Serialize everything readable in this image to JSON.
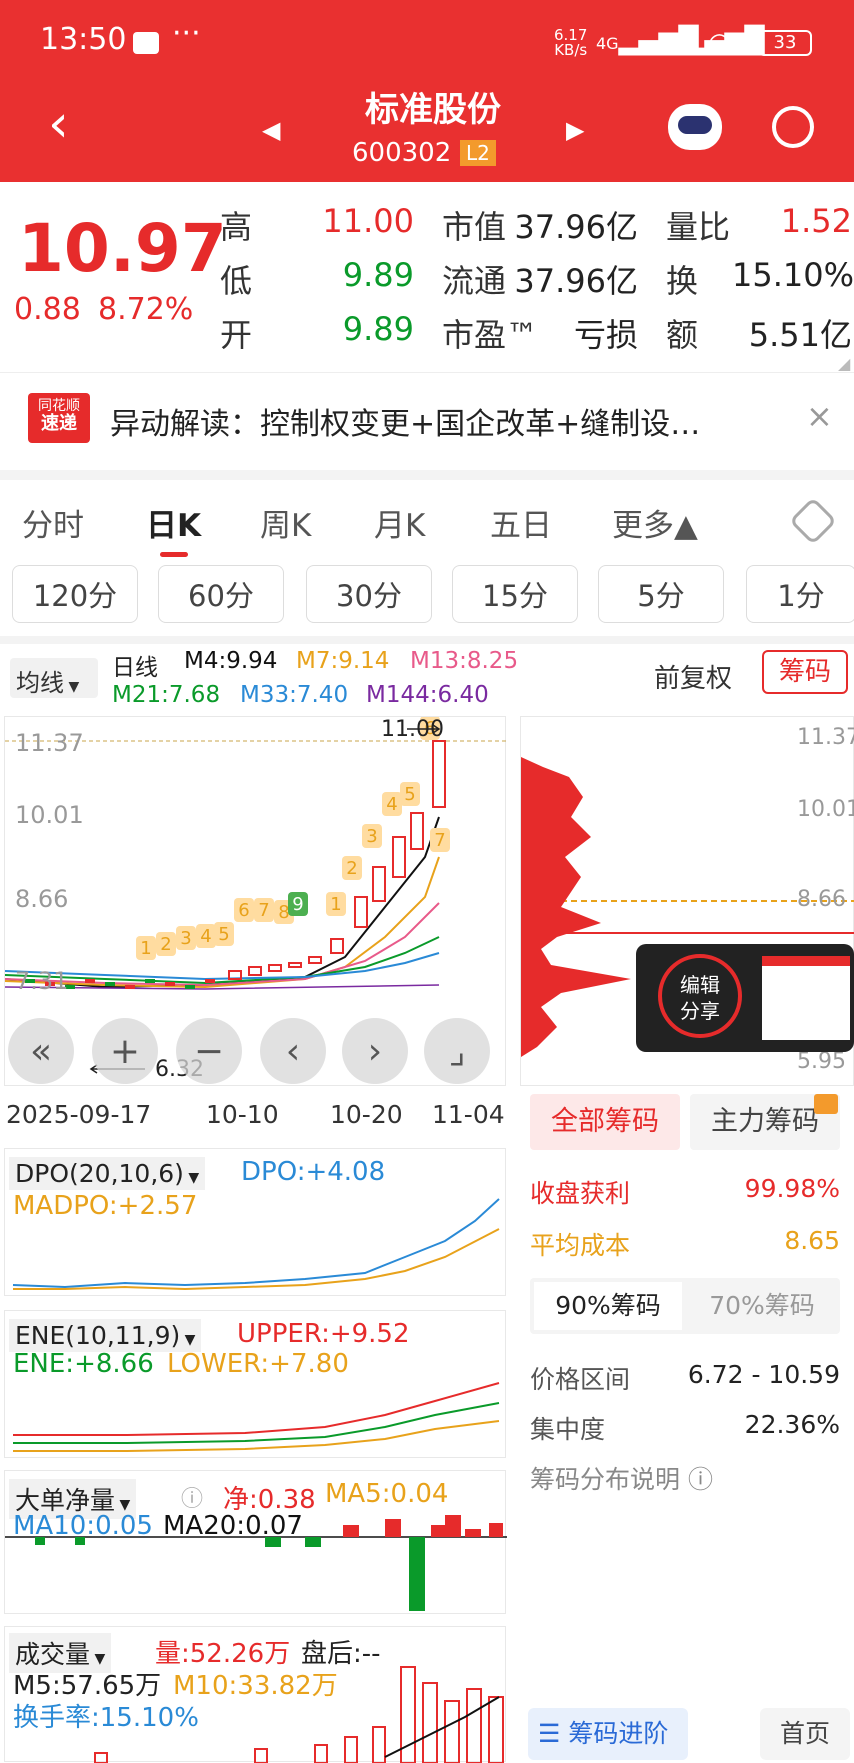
{
  "status_bar": {
    "time": "13:50",
    "dots": "···",
    "net_speed_top": "6.17",
    "net_speed_bottom": "KB/s",
    "sig1": "4G",
    "sig2": "4G",
    "battery": "33"
  },
  "header": {
    "title": "标准股份",
    "code": "600302",
    "badge": "L2"
  },
  "quote": {
    "price": "10.97",
    "change": "0.88",
    "change_pct": "8.72%",
    "rows": [
      [
        {
          "label": "高",
          "value": "11.00",
          "color": "red"
        },
        {
          "label": "市值",
          "value": "37.96亿"
        },
        {
          "label": "量比",
          "value": "1.52",
          "color": "red"
        }
      ],
      [
        {
          "label": "低",
          "value": "9.89",
          "color": "green"
        },
        {
          "label": "流通",
          "value": "37.96亿"
        },
        {
          "label": "换",
          "value": "15.10%"
        }
      ],
      [
        {
          "label": "开",
          "value": "9.89",
          "color": "green"
        },
        {
          "label": "市盈™",
          "value": "亏损"
        },
        {
          "label": "额",
          "value": "5.51亿"
        }
      ]
    ]
  },
  "banner": {
    "logo_top": "同花顺",
    "logo_bottom": "速递",
    "text": "异动解读：控制权变更+国企改革+缝制设…"
  },
  "period_tabs": [
    "分时",
    "日K",
    "周K",
    "月K",
    "五日",
    "更多▲"
  ],
  "minute_tabs": [
    "120分",
    "60分",
    "30分",
    "15分",
    "5分",
    "1分"
  ],
  "ma_bar": {
    "dropdown": "均线",
    "label": "日线",
    "m4": "M4:9.94",
    "m7": "M7:9.14",
    "m13": "M13:8.25",
    "m21": "M21:7.68",
    "m33": "M33:7.40",
    "m144": "M144:6.40",
    "fq": "前复权",
    "chip_btn": "筹码"
  },
  "colors": {
    "red": "#e62b2b",
    "green": "#0a9a2a",
    "orange": "#e8a21b",
    "pink": "#e85a8a",
    "blue": "#2a8ad6",
    "purple": "#7a2aa0",
    "black": "#111"
  },
  "kline": {
    "y_ticks": [
      "11.37",
      "10.01",
      "8.66",
      "7.31",
      "5.95"
    ],
    "high_label": "11.00",
    "low_label": "6.32",
    "x_labels": [
      "2025-09-17",
      "10-10",
      "10-20",
      "11-04"
    ],
    "signals": [
      "1",
      "2",
      "3",
      "4",
      "5",
      "6",
      "7",
      "8",
      "9",
      "1",
      "2",
      "3",
      "4",
      "5",
      "6",
      "7"
    ]
  },
  "chip_panel": {
    "y_ticks": [
      "11.37",
      "10.01",
      "8.66",
      "5.95"
    ],
    "share_popup": {
      "line1": "编辑",
      "line2": "分享"
    },
    "tabs": [
      "全部筹码",
      "主力筹码"
    ],
    "profit_label": "收盘获利",
    "profit_value": "99.98%",
    "cost_label": "平均成本",
    "cost_value": "8.65",
    "ratio_tabs": [
      "90%筹码",
      "70%筹码"
    ],
    "range_label": "价格区间",
    "range_value": "6.72 - 10.59",
    "conc_label": "集中度",
    "conc_value": "22.36%",
    "explain": "筹码分布说明",
    "bottom_btn": "筹码进阶",
    "bottom_btn2": "首页"
  },
  "dpo": {
    "name": "DPO(20,10,6)",
    "dpo": "DPO:+4.08",
    "madpo": "MADPO:+2.57"
  },
  "ene": {
    "name": "ENE(10,11,9)",
    "upper": "UPPER:+9.52",
    "ene": "ENE:+8.66",
    "lower": "LOWER:+7.80"
  },
  "bigorder": {
    "name": "大单净量",
    "net": "净:0.38",
    "ma5": "MA5:0.04",
    "ma10": "MA10:0.05",
    "ma20": "MA20:0.07"
  },
  "volume": {
    "name": "成交量",
    "vol": "量:52.26万",
    "after": "盘后:--",
    "m5": "M5:57.65万",
    "m10": "M10:33.82万",
    "turnover": "换手率:15.10%"
  }
}
